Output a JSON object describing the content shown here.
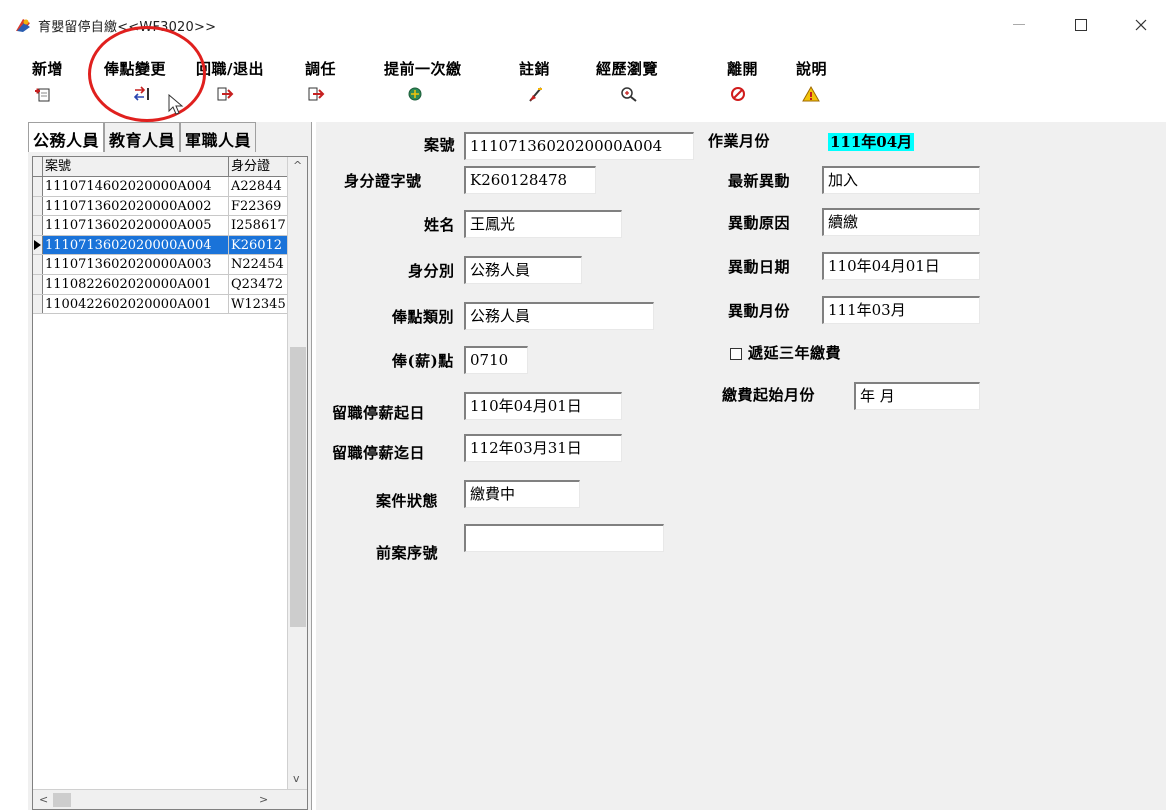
{
  "window": {
    "title": "育嬰留停自繳<<WF3020>>",
    "minimize_glyph": "—",
    "maximize_glyph": "☐",
    "close_glyph": "✕"
  },
  "toolbar": {
    "buttons": [
      {
        "label": "新增",
        "icon": "add-record-icon"
      },
      {
        "label": "俸點變更",
        "icon": "change-points-icon"
      },
      {
        "label": "回職/退出",
        "icon": "return-exit-icon"
      },
      {
        "label": "調任",
        "icon": "transfer-icon"
      },
      {
        "label": "提前一次繳",
        "icon": "prepay-icon"
      },
      {
        "label": "註銷",
        "icon": "cancel-record-icon"
      },
      {
        "label": "經歷瀏覽",
        "icon": "browse-history-icon"
      },
      {
        "label": "離開",
        "icon": "exit-icon"
      },
      {
        "label": "說明",
        "icon": "help-icon"
      }
    ],
    "highlight_color": "#e0201e"
  },
  "left": {
    "tabs": [
      "公務人員",
      "教育人員",
      "軍職人員"
    ],
    "grid": {
      "columns": [
        "案號",
        "身分證"
      ],
      "rows": [
        {
          "case_no": "1110714602020000A004",
          "id_no": "A22844"
        },
        {
          "case_no": "1110713602020000A002",
          "id_no": "F22369"
        },
        {
          "case_no": "1110713602020000A005",
          "id_no": "I258617"
        },
        {
          "case_no": "1110713602020000A004",
          "id_no": "K26012"
        },
        {
          "case_no": "1110713602020000A003",
          "id_no": "N22454"
        },
        {
          "case_no": "1110822602020000A001",
          "id_no": "Q23472"
        },
        {
          "case_no": "1100422602020000A001",
          "id_no": "W12345"
        }
      ],
      "selected_index": 3,
      "selection_color": "#1a73d9"
    }
  },
  "form": {
    "case_no": {
      "label": "案號",
      "value": "1110713602020000A004"
    },
    "id_no": {
      "label": "身分證字號",
      "value": "K260128478"
    },
    "name": {
      "label": "姓名",
      "value": "王鳳光"
    },
    "identity": {
      "label": "身分別",
      "value": "公務人員"
    },
    "points_type": {
      "label": "俸點類別",
      "value": "公務人員"
    },
    "points": {
      "label": "俸(薪)點",
      "value": "0710"
    },
    "leave_start": {
      "label": "留職停薪起日",
      "value": "110年04月01日"
    },
    "leave_end": {
      "label": "留職停薪迄日",
      "value": "112年03月31日"
    },
    "case_status": {
      "label": "案件狀態",
      "value": "繳費中"
    },
    "prev_case_no": {
      "label": "前案序號",
      "value": ""
    },
    "work_month": {
      "label": "作業月份",
      "value": "111年04月",
      "highlight": "#00ffff"
    },
    "latest_change": {
      "label": "最新異動",
      "value": "加入"
    },
    "change_reason": {
      "label": "異動原因",
      "value": "續繳"
    },
    "change_date": {
      "label": "異動日期",
      "value": "110年04月01日"
    },
    "change_month": {
      "label": "異動月份",
      "value": "111年03月"
    },
    "defer_payment": {
      "label": "遞延三年繳費",
      "checked": false
    },
    "pay_start_month": {
      "label": "繳費起始月份",
      "value": "  年  月"
    }
  }
}
